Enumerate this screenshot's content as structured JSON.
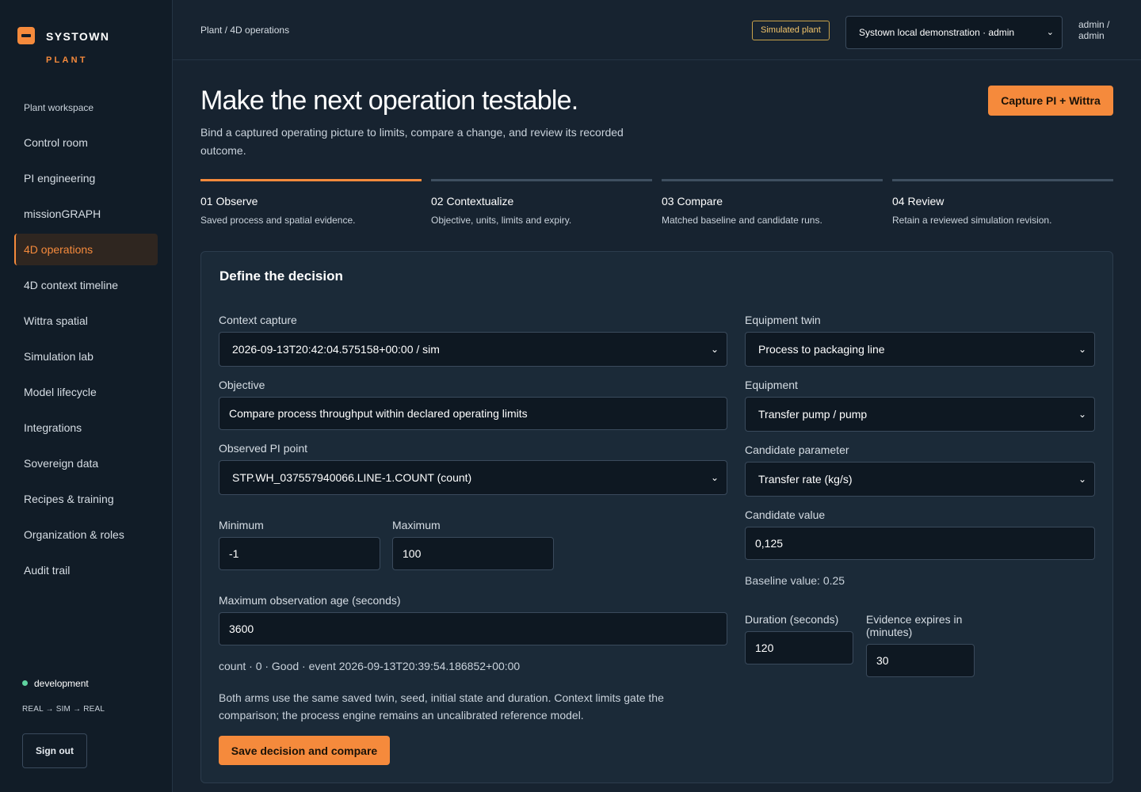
{
  "brand": {
    "name": "SYSTOWN",
    "sub": "PLANT"
  },
  "sidebar": {
    "section": "Plant workspace",
    "items": [
      {
        "label": "Control room",
        "active": false
      },
      {
        "label": "PI engineering",
        "active": false
      },
      {
        "label": "missionGRAPH",
        "active": false
      },
      {
        "label": "4D operations",
        "active": true
      },
      {
        "label": "4D context timeline",
        "active": false
      },
      {
        "label": "Wittra spatial",
        "active": false
      },
      {
        "label": "Simulation lab",
        "active": false
      },
      {
        "label": "Model lifecycle",
        "active": false
      },
      {
        "label": "Integrations",
        "active": false
      },
      {
        "label": "Sovereign data",
        "active": false
      },
      {
        "label": "Recipes & training",
        "active": false
      },
      {
        "label": "Organization & roles",
        "active": false
      },
      {
        "label": "Audit trail",
        "active": false
      }
    ],
    "environment": "development",
    "loop": "REAL → SIM → REAL",
    "sign_out": "Sign out"
  },
  "topbar": {
    "breadcrumb": "Plant / 4D operations",
    "badge": "Simulated plant",
    "workspace": "Systown local demonstration · admin",
    "user": "admin / admin"
  },
  "hero": {
    "title": "Make the next operation testable.",
    "description": "Bind a captured operating picture to limits, compare a change, and review its recorded outcome.",
    "capture_button": "Capture PI + Wittra"
  },
  "steps": [
    {
      "title": "01 Observe",
      "desc": "Saved process and spatial evidence.",
      "active": true
    },
    {
      "title": "02 Contextualize",
      "desc": "Objective, units, limits and expiry.",
      "active": false
    },
    {
      "title": "03 Compare",
      "desc": "Matched baseline and candidate runs.",
      "active": false
    },
    {
      "title": "04 Review",
      "desc": "Retain a reviewed simulation revision.",
      "active": false
    }
  ],
  "form": {
    "title": "Define the decision",
    "context_capture": {
      "label": "Context capture",
      "value": "2026-09-13T20:42:04.575158+00:00 / sim"
    },
    "objective": {
      "label": "Objective",
      "value": "Compare process throughput within declared operating limits"
    },
    "pi_point": {
      "label": "Observed PI point",
      "value": "STP.WH_037557940066.LINE-1.COUNT (count)"
    },
    "minimum": {
      "label": "Minimum",
      "value": "-1"
    },
    "maximum": {
      "label": "Maximum",
      "value": "100"
    },
    "max_age": {
      "label": "Maximum observation age (seconds)",
      "value": "3600"
    },
    "observation_note": "count · 0 · Good · event 2026-09-13T20:39:54.186852+00:00",
    "footnote": "Both arms use the same saved twin, seed, initial state and duration. Context limits gate the comparison; the process engine remains an uncalibrated reference model.",
    "save_button": "Save decision and compare",
    "equipment_twin": {
      "label": "Equipment twin",
      "value": "Process to packaging line"
    },
    "equipment": {
      "label": "Equipment",
      "value": "Transfer pump / pump"
    },
    "candidate_parameter": {
      "label": "Candidate parameter",
      "value": "Transfer rate (kg/s)"
    },
    "candidate_value": {
      "label": "Candidate value",
      "value": "0,125"
    },
    "baseline": "Baseline value: 0.25",
    "duration": {
      "label": "Duration (seconds)",
      "value": "120"
    },
    "expiry": {
      "label": "Evidence expires in (minutes)",
      "value": "30"
    }
  }
}
